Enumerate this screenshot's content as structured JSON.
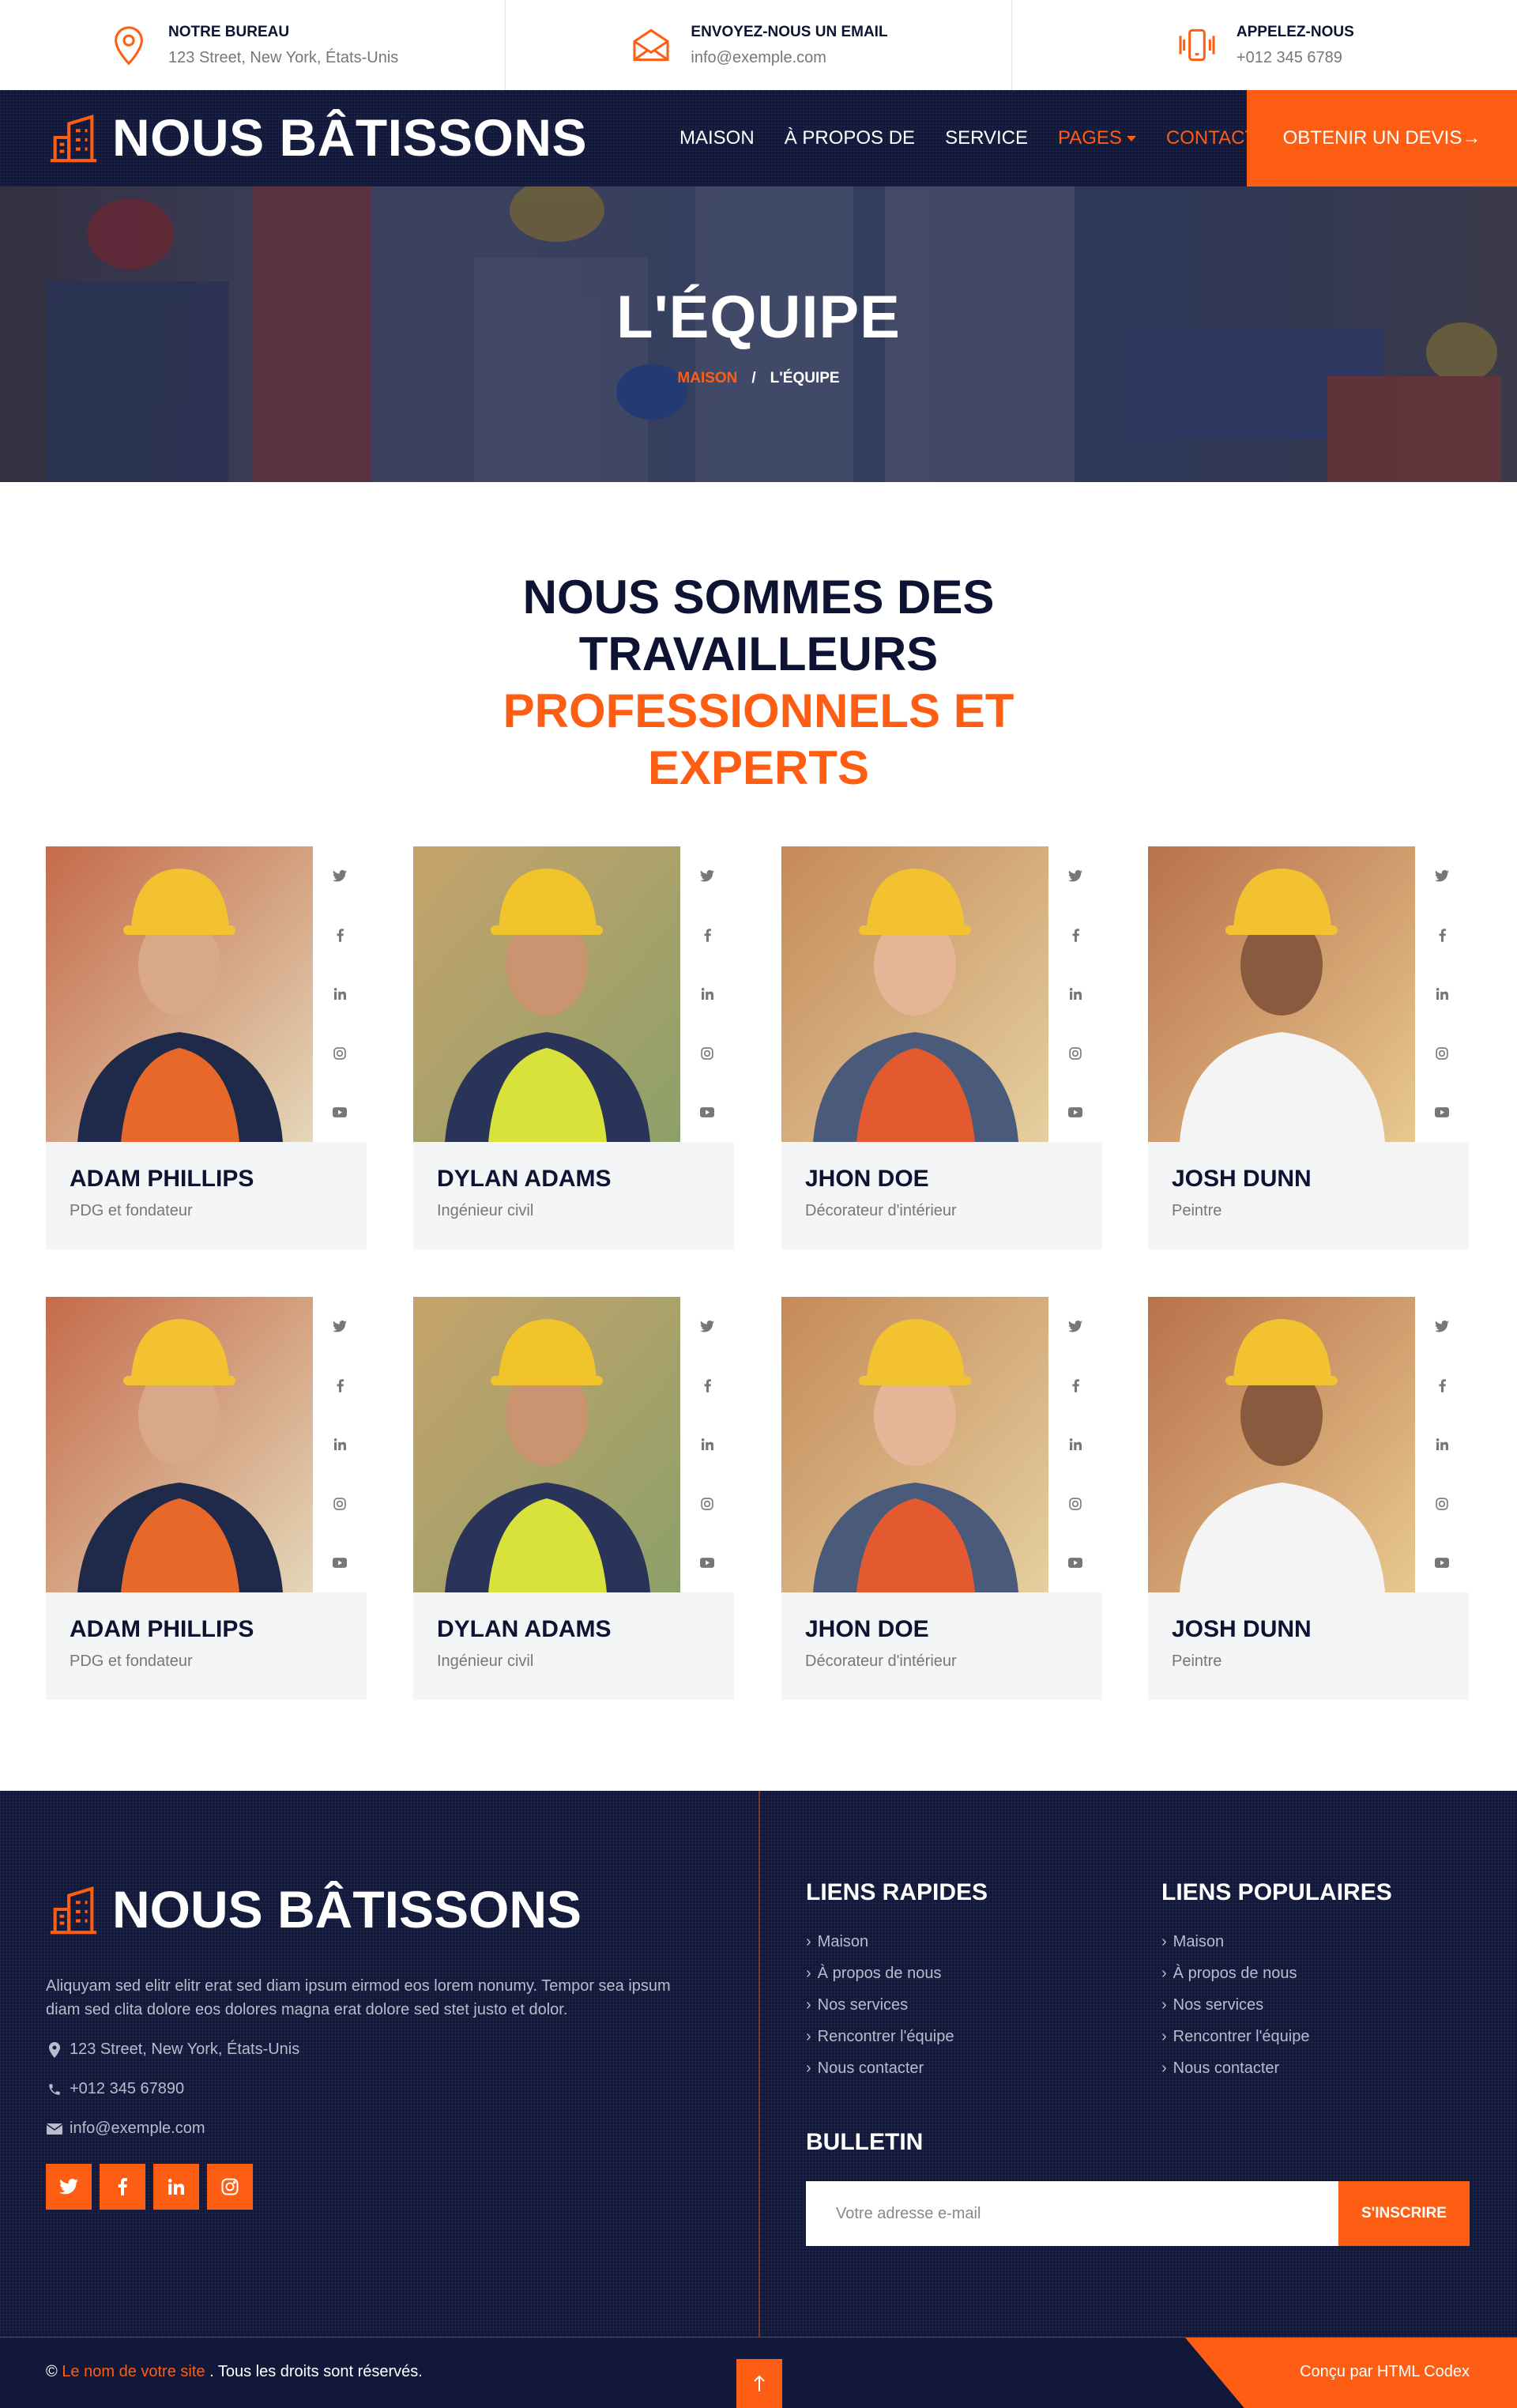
{
  "topbar": {
    "office": {
      "title": "NOTRE BUREAU",
      "value": "123 Street, New York, États-Unis",
      "icon": "map-pin-icon"
    },
    "email": {
      "title": "ENVOYEZ-NOUS UN EMAIL",
      "value": "info@exemple.com",
      "icon": "envelope-icon"
    },
    "phone": {
      "title": "APPELEZ-NOUS",
      "value": "+012 345 6789",
      "icon": "phone-ringing-icon"
    }
  },
  "navbar": {
    "brand": "NOUS BÂTISSONS",
    "items": [
      "MAISON",
      "À PROPOS DE",
      "SERVICE",
      "PAGES",
      "CONTACT"
    ],
    "quote_button": "OBTENIR UN DEVIS→"
  },
  "hero": {
    "title": "L'ÉQUIPE",
    "breadcrumb_home": "MAISON",
    "breadcrumb_sep": "/",
    "breadcrumb_current": "L'ÉQUIPE"
  },
  "section": {
    "title_line1": "NOUS SOMMES DES",
    "title_line2": "TRAVAILLEURS",
    "title_line3": "PROFESSIONNELS ET",
    "title_line4": "EXPERTS"
  },
  "team": [
    {
      "name": "ADAM PHILLIPS",
      "role": "PDG et fondateur"
    },
    {
      "name": "DYLAN ADAMS",
      "role": "Ingénieur civil"
    },
    {
      "name": "JHON DOE",
      "role": "Décorateur d'intérieur"
    },
    {
      "name": "JOSH DUNN",
      "role": "Peintre"
    },
    {
      "name": "ADAM PHILLIPS",
      "role": "PDG et fondateur"
    },
    {
      "name": "DYLAN ADAMS",
      "role": "Ingénieur civil"
    },
    {
      "name": "JHON DOE",
      "role": "Décorateur d'intérieur"
    },
    {
      "name": "JOSH DUNN",
      "role": "Peintre"
    }
  ],
  "footer": {
    "brand": "NOUS BÂTISSONS",
    "about": "Aliquyam sed elitr elitr erat sed diam ipsum eirmod eos lorem nonumy. Tempor sea ipsum diam sed clita dolore eos dolores magna erat dolore sed stet justo et dolor.",
    "address": "123 Street, New York, États-Unis",
    "phone": "+012 345 67890",
    "email": "info@exemple.com",
    "quick_title": "LIENS RAPIDES",
    "quick_links": [
      "Maison",
      "À propos de nous",
      "Nos services",
      "Rencontrer l'équipe",
      "Nous contacter"
    ],
    "popular_title": "LIENS POPULAIRES",
    "popular_links": [
      "Maison",
      "À propos de nous",
      "Nos services",
      "Rencontrer l'équipe",
      "Nous contacter"
    ],
    "newsletter_title": "BULLETIN",
    "newsletter_placeholder": "Votre adresse e-mail",
    "newsletter_button": "S'INSCRIRE"
  },
  "copyright": {
    "symbol": "©",
    "site_name": "Le nom de votre site",
    "rights": ". Tous les droits sont réservés.",
    "designed_by": "Conçu par ",
    "designer": "HTML Codex"
  },
  "colors": {
    "accent": "#fe5d14",
    "navy": "#11183a",
    "dark_text": "#0e1333"
  }
}
